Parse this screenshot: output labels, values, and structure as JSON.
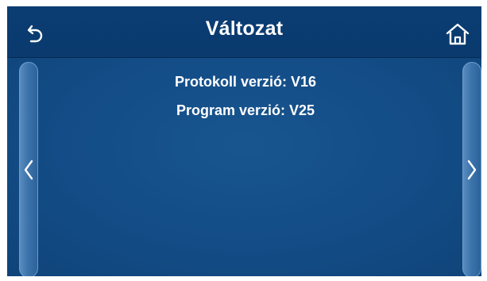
{
  "header": {
    "title": "Változat"
  },
  "icons": {
    "back": "back-arrow-icon",
    "home": "home-icon",
    "prev": "chevron-left-icon",
    "next": "chevron-right-icon"
  },
  "info": {
    "protocol_version": "Protokoll verzió: V16",
    "program_version": "Program verzió: V25"
  },
  "colors": {
    "background": "#134a82",
    "header": "#0b3d73",
    "side_buttons": "#3c74ac",
    "text": "#ffffff"
  }
}
